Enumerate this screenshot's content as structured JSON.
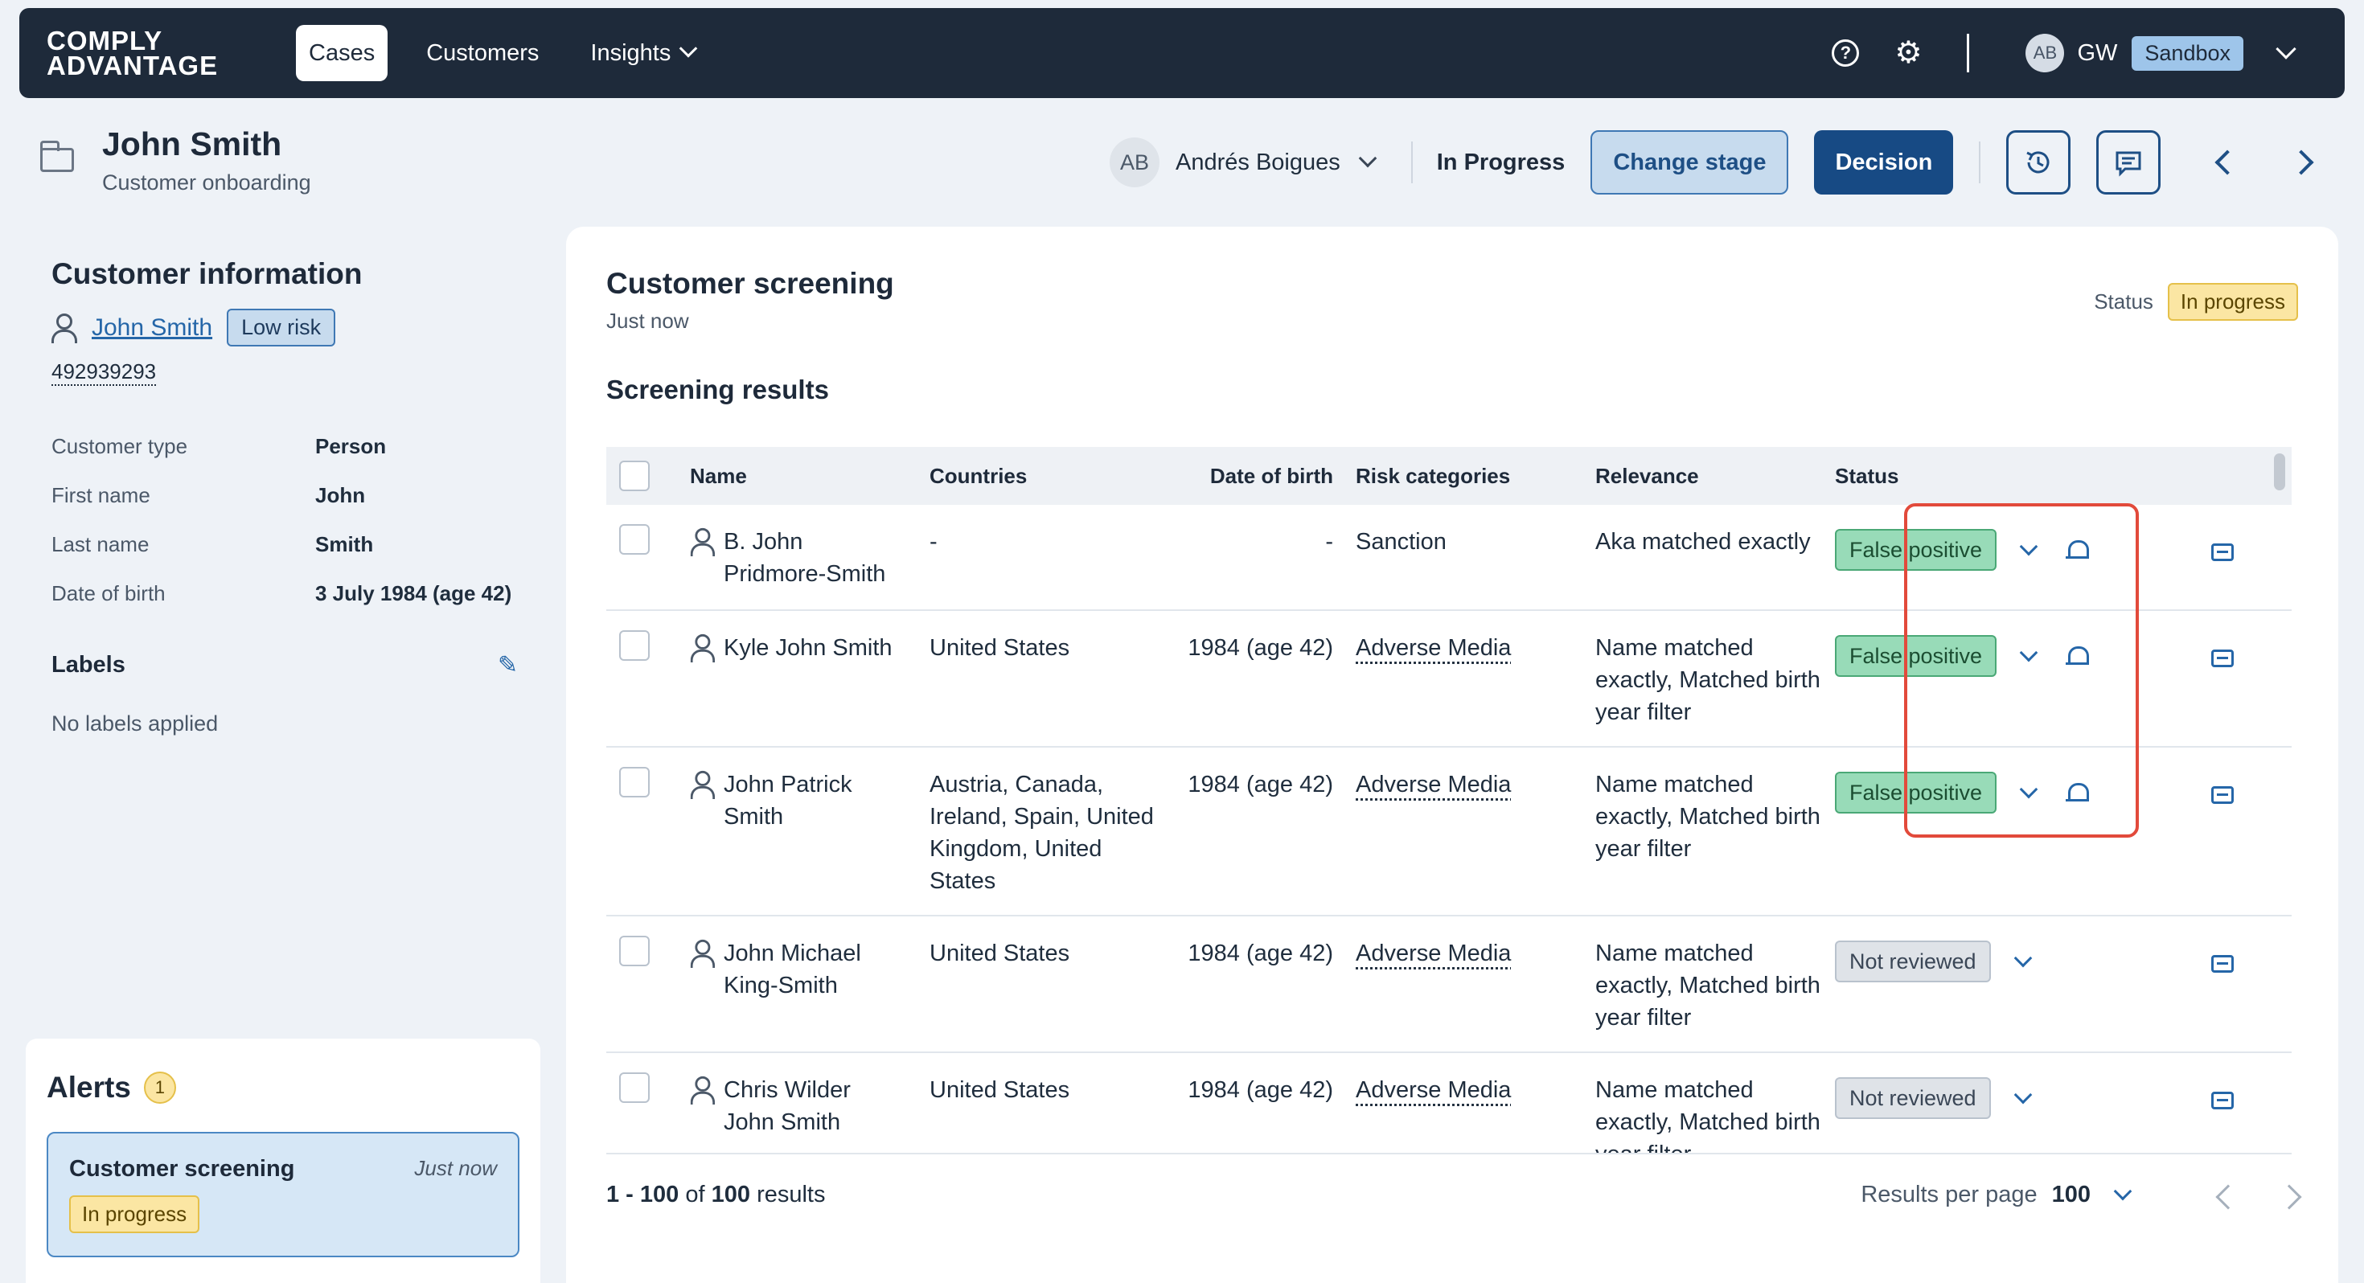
{
  "nav": {
    "logo_line1": "COMPLY",
    "logo_line2": "ADVANTAGE",
    "items": [
      "Cases",
      "Customers",
      "Insights"
    ],
    "user_initials": "AB",
    "user_code": "GW",
    "env_badge": "Sandbox",
    "help_icon": "?",
    "settings_icon": "⚙"
  },
  "case": {
    "title": "John Smith",
    "subtitle": "Customer onboarding",
    "assignee_initials": "AB",
    "assignee_name": "Andrés Boigues",
    "stage": "In Progress",
    "change_stage_label": "Change stage",
    "decision_label": "Decision"
  },
  "customer": {
    "section_title": "Customer information",
    "name": "John Smith",
    "risk": "Low risk",
    "id": "492939293",
    "fields": [
      {
        "k": "Customer type",
        "v": "Person"
      },
      {
        "k": "First name",
        "v": "John"
      },
      {
        "k": "Last name",
        "v": "Smith"
      },
      {
        "k": "Date of birth",
        "v": "3 July 1984 (age 42)"
      }
    ],
    "labels_title": "Labels",
    "no_labels": "No labels applied"
  },
  "alerts": {
    "title": "Alerts",
    "count": "1",
    "card_name": "Customer screening",
    "card_time": "Just now",
    "card_status": "In progress"
  },
  "screening": {
    "title": "Customer screening",
    "time": "Just now",
    "status_label": "Status",
    "status_value": "In progress",
    "results_title": "Screening results",
    "columns": [
      "Name",
      "Countries",
      "Date of birth",
      "Risk categories",
      "Relevance",
      "Status"
    ],
    "rows": [
      {
        "name": "B. John Pridmore-Smith",
        "countries": "-",
        "dob": "-",
        "risk": "Sanction",
        "relevance": "Aka matched exactly",
        "status": "False positive"
      },
      {
        "name": "Kyle John Smith",
        "countries": "United States",
        "dob": "1984 (age 42)",
        "risk": "Adverse Media",
        "relevance": "Name matched exactly, Matched birth year filter",
        "status": "False positive"
      },
      {
        "name": "John Patrick Smith",
        "countries": "Austria, Canada, Ireland, Spain, United Kingdom, United States",
        "dob": "1984 (age 42)",
        "risk": "Adverse Media",
        "relevance": "Name matched exactly, Matched birth year filter",
        "status": "False positive"
      },
      {
        "name": "John Michael King-Smith",
        "countries": "United States",
        "dob": "1984 (age 42)",
        "risk": "Adverse Media",
        "relevance": "Name matched exactly, Matched birth year filter",
        "status": "Not reviewed"
      },
      {
        "name": "Chris Wilder John Smith",
        "countries": "United States",
        "dob": "1984 (age 42)",
        "risk": "Adverse Media",
        "relevance": "Name matched exactly, Matched birth year filter",
        "status": "Not reviewed"
      }
    ],
    "footer_range": "1 - 100",
    "footer_of": "of",
    "footer_total": "100",
    "footer_results": "results",
    "rpp_label": "Results per page",
    "rpp_value": "100"
  }
}
